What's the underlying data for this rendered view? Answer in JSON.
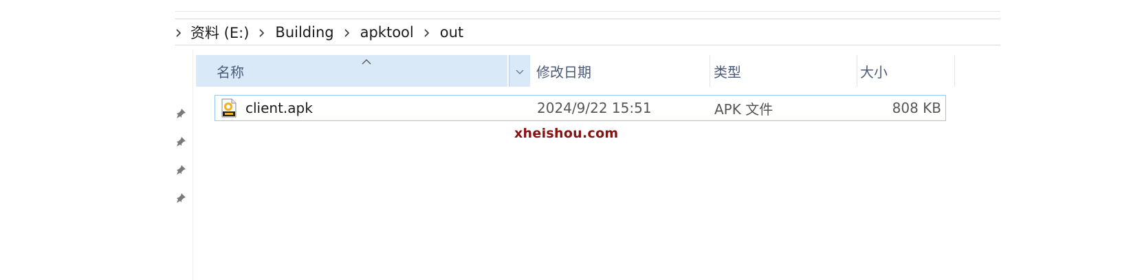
{
  "breadcrumb": {
    "items": [
      "资料 (E:)",
      "Building",
      "apktool",
      "out"
    ]
  },
  "columns": {
    "name": "名称",
    "date_modified": "修改日期",
    "type": "类型",
    "size": "大小"
  },
  "files": [
    {
      "name": "client.apk",
      "date_modified": "2024/9/22 15:51",
      "type": "APK 文件",
      "size": "808 KB",
      "icon": "apk-file-icon"
    }
  ],
  "watermark": "xheishou.com",
  "quick_access_pins": 4,
  "colors": {
    "header_highlight": "#d9e9f8",
    "selection_border": "#99c8ef",
    "header_text": "#4a5a78",
    "watermark": "#8b1010"
  }
}
